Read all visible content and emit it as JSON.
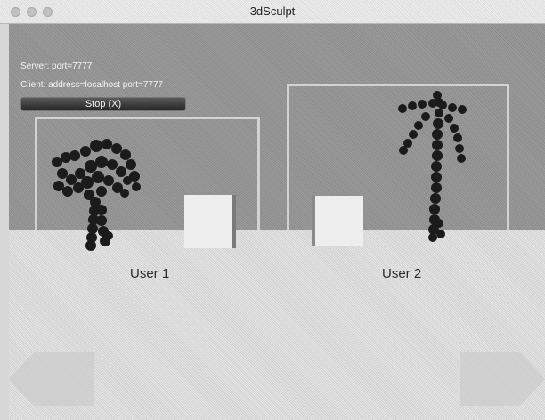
{
  "window": {
    "title": "3dSculpt"
  },
  "overlay": {
    "server_text": "Server: port=7777",
    "client_text": "Client: address=localhost port=7777",
    "stop_label": "Stop (X)"
  },
  "scene": {
    "user1_label": "User 1",
    "user2_label": "User 2"
  },
  "icons": {
    "nav_left": "chevron-left-icon",
    "nav_right": "chevron-right-icon"
  }
}
